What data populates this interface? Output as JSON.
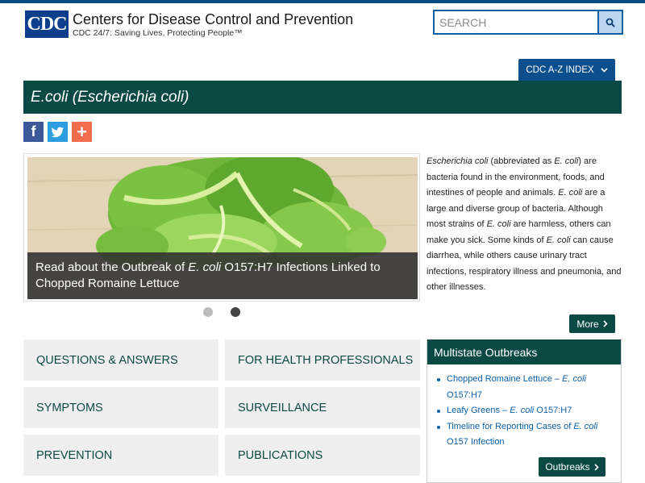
{
  "header": {
    "logo_text": "CDC",
    "site_title": "Centers for Disease Control and Prevention",
    "tagline": "CDC 24/7: Saving Lives, Protecting People™",
    "search_placeholder": "SEARCH",
    "az_index_label": "CDC A-Z INDEX"
  },
  "page": {
    "title": "E.coli (Escherichia coli)"
  },
  "carousel": {
    "caption_prefix": "Read about the Outbreak of ",
    "caption_italic": "E. coli",
    "caption_suffix": " O157:H7 Infections Linked to Chopped Romaine Lettuce",
    "slide_count": 2,
    "active_slide": 2
  },
  "intro": {
    "parts": [
      {
        "text": "Escherichia coli",
        "italic": true
      },
      {
        "text": " (abbreviated as ",
        "italic": false
      },
      {
        "text": "E. coli",
        "italic": true
      },
      {
        "text": ") are bacteria found in the environment, foods, and intestines of people and animals. ",
        "italic": false
      },
      {
        "text": "E. coli",
        "italic": true
      },
      {
        "text": " are a large and diverse group of bacteria. Although most strains of ",
        "italic": false
      },
      {
        "text": "E. coli",
        "italic": true
      },
      {
        "text": " are harmless, others can make you sick. Some kinds of ",
        "italic": false
      },
      {
        "text": "E. coli",
        "italic": true
      },
      {
        "text": " can cause diarrhea, while others cause urinary tract infections, respiratory illness and pneumonia, and other illnesses.",
        "italic": false
      }
    ],
    "more_label": "More"
  },
  "tiles": [
    "QUESTIONS & ANSWERS",
    "FOR HEALTH PROFESSIONALS",
    "SYMPTOMS",
    "SURVEILLANCE",
    "PREVENTION",
    "PUBLICATIONS"
  ],
  "outbreaks": {
    "heading": "Multistate Outbreaks",
    "links": [
      {
        "parts": [
          {
            "text": "Chopped Romaine Lettuce – ",
            "italic": false
          },
          {
            "text": "E. coli",
            "italic": true
          },
          {
            "text": " O157:H7",
            "italic": false
          }
        ]
      },
      {
        "parts": [
          {
            "text": "Leafy Greens – ",
            "italic": false
          },
          {
            "text": "E. coli",
            "italic": true
          },
          {
            "text": " O157:H7",
            "italic": false
          }
        ]
      },
      {
        "parts": [
          {
            "text": "Timeline for Reporting Cases of ",
            "italic": false
          },
          {
            "text": "E. coli",
            "italic": true
          },
          {
            "text": " O157 Infection",
            "italic": false
          }
        ]
      }
    ],
    "button_label": "Outbreaks"
  },
  "colors": {
    "brand_navy": "#0d3f8d",
    "title_bar_green": "#0b4a44",
    "link_blue": "#0b5fa5",
    "facebook": "#3b5998",
    "twitter": "#2b9ee2",
    "addthis": "#f26c4f"
  },
  "icons": {
    "search": "magnifier-icon",
    "chevron": "chevron-down-icon",
    "arrow": "chevron-right-icon"
  }
}
